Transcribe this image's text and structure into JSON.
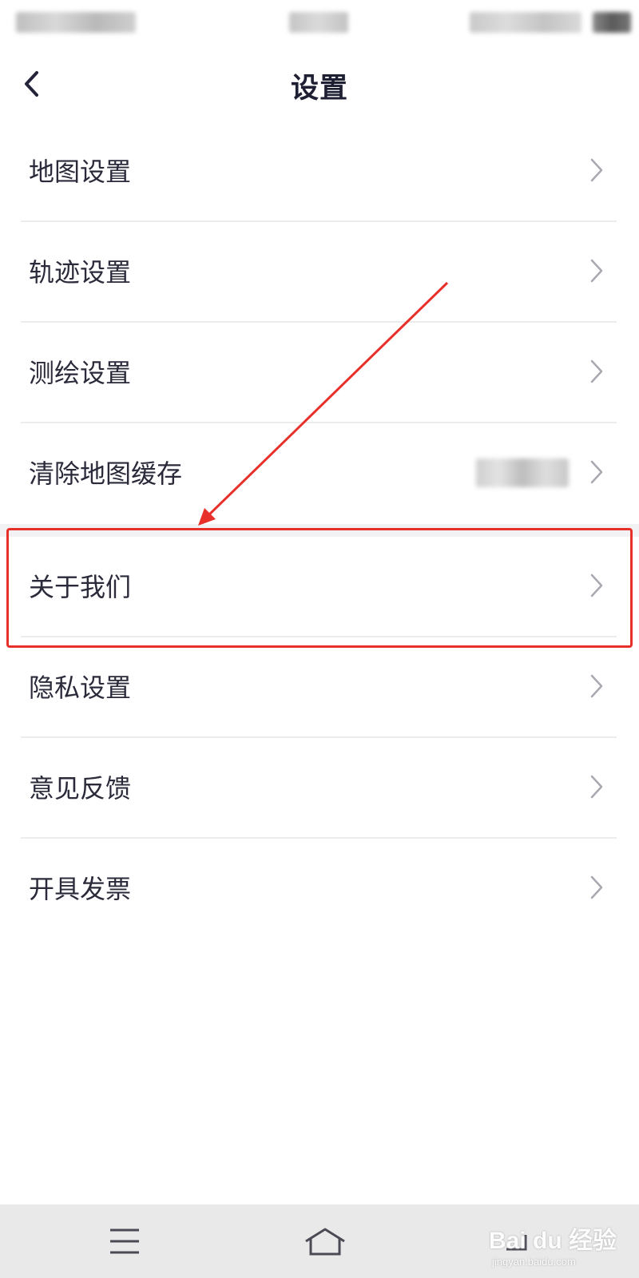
{
  "header": {
    "title": "设置",
    "back_icon": "chevron-left-icon"
  },
  "settings": {
    "items": [
      {
        "label": "地图设置"
      },
      {
        "label": "轨迹设置"
      },
      {
        "label": "测绘设置"
      },
      {
        "label": "清除地图缓存"
      },
      {
        "label": "关于我们"
      },
      {
        "label": "隐私设置"
      },
      {
        "label": "意见反馈"
      },
      {
        "label": "开具发票"
      }
    ]
  },
  "annotation": {
    "color": "#e8302a",
    "highlighted_item": "关于我们"
  },
  "nav_bar": {
    "icons": [
      "menu-icon",
      "home-icon",
      "back-icon"
    ]
  },
  "watermark": {
    "main": "Bai du 经验",
    "sub": "jingyan.baidu.com"
  },
  "colors": {
    "background": "#ffffff",
    "text": "#2a2a3a",
    "divider": "#ececec",
    "nav_bar": "#e9e9ea"
  }
}
